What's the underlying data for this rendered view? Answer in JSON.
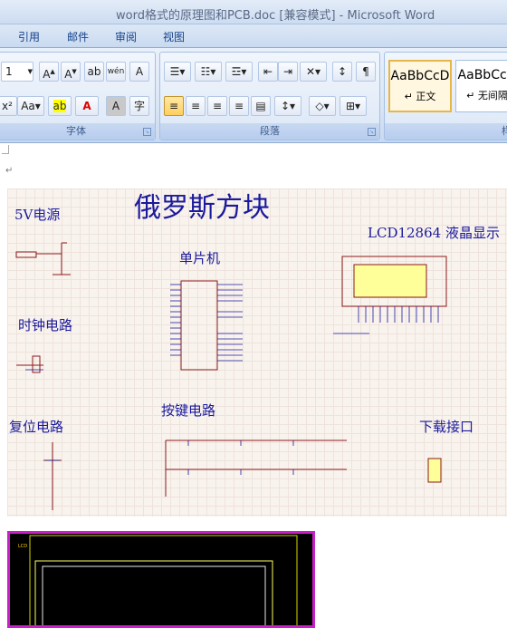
{
  "window": {
    "title": "word格式的原理图和PCB.doc [兼容模式] - Microsoft Word"
  },
  "tabs": [
    "引用",
    "邮件",
    "审阅",
    "视图"
  ],
  "ribbon": {
    "font_group": {
      "label": "字体",
      "size_value": "1"
    },
    "paragraph_group": {
      "label": "段落"
    },
    "styles_group": {
      "label": "样",
      "styles": [
        {
          "sample": "AaBbCcD",
          "name": "↵ 正文"
        },
        {
          "sample": "AaBbCcD",
          "name": "↵ 无间隔"
        }
      ]
    }
  },
  "schematic": {
    "title": "俄罗斯方块",
    "sections": {
      "power": "5V电源",
      "mcu": "单片机",
      "lcd": "LCD12864 液晶显示",
      "clock": "时钟电路",
      "reset": "复位电路",
      "keys": "按键电路",
      "download": "下载接口"
    }
  },
  "pcb": {
    "label": "LCD"
  }
}
